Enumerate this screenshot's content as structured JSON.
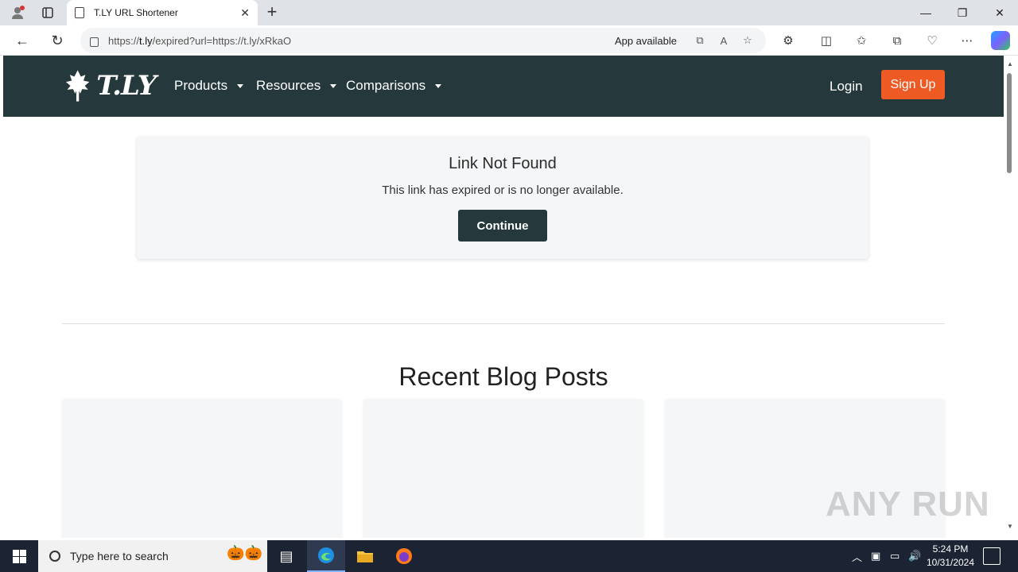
{
  "browser": {
    "tab_title": "T.LY URL Shortener",
    "url_prefix": "https://",
    "url_host": "t.ly",
    "url_rest": "/expired?url=https://t.ly/xRkaO",
    "app_available": "App available"
  },
  "header": {
    "logo_text": "T.LY",
    "menu": [
      {
        "label": "Products"
      },
      {
        "label": "Resources"
      },
      {
        "label": "Comparisons"
      }
    ],
    "login_label": "Login",
    "signup_label": "Sign Up"
  },
  "card": {
    "title": "Link Not Found",
    "message": "This link has expired or is no longer available.",
    "continue_label": "Continue"
  },
  "blog": {
    "title": "Recent Blog Posts"
  },
  "watermark": "ANY RUN",
  "taskbar": {
    "search_placeholder": "Type here to search",
    "time": "5:24 PM",
    "date": "10/31/2024"
  },
  "colors": {
    "header_bg": "#25393c",
    "signup_bg": "#ee5a24",
    "card_bg": "#f5f6f8"
  }
}
